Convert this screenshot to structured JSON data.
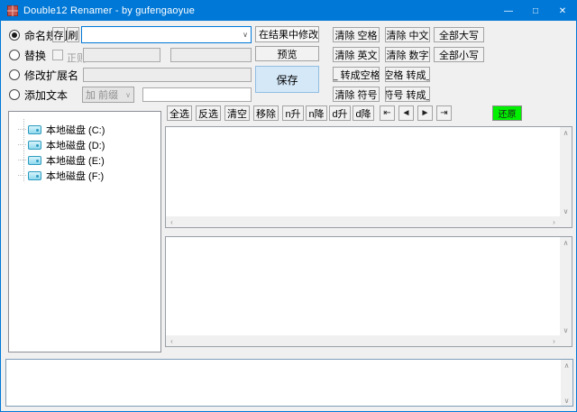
{
  "window": {
    "title": "Double12 Renamer - by gufengaoyue",
    "accent_color": "#0078d7",
    "minimize_glyph": "—",
    "maximize_glyph": "□",
    "close_glyph": "✕"
  },
  "rules": {
    "modes": [
      {
        "label": "命名规则",
        "selected": true
      },
      {
        "label": "替换",
        "selected": false
      },
      {
        "label": "修改扩展名",
        "selected": false
      },
      {
        "label": "添加文本",
        "selected": false
      }
    ],
    "store_button": "存",
    "brush_button": "刷",
    "regex_label": "正则",
    "rule_combo_value": "",
    "replace_find_value": "",
    "replace_with_value": "",
    "extension_value": "",
    "addtext_mode_value": "加 前缀",
    "addtext_value": ""
  },
  "actions": {
    "scope_combo_value": "在结果中修改",
    "preview_label": "预览",
    "save_label": "保存"
  },
  "quick": {
    "items": [
      "清除 空格",
      "清除 中文",
      "全部大写",
      "清除 英文",
      "清除 数字",
      "全部小写",
      "_ 转成空格",
      "空格 转成_",
      "清除 符号",
      "符号 转成_"
    ]
  },
  "toolbar": {
    "items": [
      "全选",
      "反选",
      "清空",
      "移除",
      "n升",
      "n降",
      "d升",
      "d降"
    ],
    "nav": [
      "⇤",
      "◄",
      "►",
      "⇥"
    ],
    "restore_label": "还原",
    "restore_color": "#00f000"
  },
  "tree": {
    "items": [
      "本地磁盘 (C:)",
      "本地磁盘 (D:)",
      "本地磁盘 (E:)",
      "本地磁盘 (F:)"
    ]
  },
  "lists": {
    "file_list": [],
    "result_list": [],
    "log_text": ""
  },
  "scrollbar": {
    "up": "∧",
    "down": "∨",
    "left": "‹",
    "right": "›"
  },
  "combo_chevron": "∨"
}
